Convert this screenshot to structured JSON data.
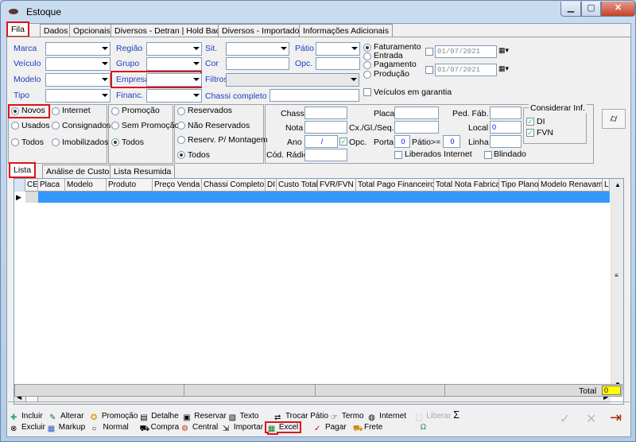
{
  "window": {
    "title": "Estoque",
    "min": "▁",
    "max": "▢",
    "close": "✕"
  },
  "main_tabs": [
    "Fila",
    "Dados",
    "Opcionais",
    "Diversos - Detran | Hold Back",
    "Diversos - Importados",
    "Informações Adicionais"
  ],
  "filters": {
    "marca": "Marca",
    "veiculo": "Veículo",
    "modelo": "Modelo",
    "tipo": "Tipo",
    "regiao": "Região",
    "grupo": "Grupo",
    "empresa": "Empresa",
    "financ": "Financ.",
    "sit": "Sit.",
    "cor": "Cor",
    "filtros": "Filtros",
    "chassi_completo": "Chassi completo",
    "patio": "Pátio",
    "opc": "Opc."
  },
  "date_radios": [
    "Faturamento",
    "Entrada",
    "Pagamento",
    "Produção"
  ],
  "date1": "01/07/2021",
  "date2": "01/07/2021",
  "veiculos_garantia": "Veículos em garantia",
  "radio_col1": [
    "Novos",
    "Usados",
    "Todos"
  ],
  "radio_col2": [
    "Internet",
    "Consignados",
    "Imobilizados"
  ],
  "radio_col3": [
    "Promoção",
    "Sem Promoção",
    "Todos"
  ],
  "radio_col4": [
    "Reservados",
    "Não Reservados",
    "Reserv. P/ Montagem",
    "Todos"
  ],
  "search": {
    "chassi": "Chassi",
    "nota": "Nota",
    "ano": "Ano",
    "ano_sep": "/",
    "opc": "Opc.",
    "cod_radio": "Cód. Rádio",
    "placa": "Placa",
    "cx": "Cx./Gl./Seq.",
    "porta": "Porta",
    "porta_val": "0",
    "patio": "Pátio>=",
    "patio_val": "0",
    "liberados": "Liberados Internet",
    "ped_fab": "Ped. Fáb.",
    "local": "Local",
    "local_val": "0",
    "linha": "Linha",
    "blindado": "Blindado",
    "considerar": "Considerar Inf.",
    "di": "DI",
    "fvn": "FVN"
  },
  "list_tabs": [
    "Lista",
    "Análise de Custos",
    "Lista Resumida"
  ],
  "columns": [
    "CE",
    "Placa",
    "Modelo",
    "Produto",
    "Preço Venda",
    "Chassi Completo",
    "DI",
    "Custo Total",
    "FVR/FVN",
    "Total Pago Financeiro",
    "Total Nota Fabrica",
    "Tipo Plano",
    "Modelo Renavam",
    "L"
  ],
  "total_label": "Total",
  "total_value": "0",
  "buttons_row1": [
    "Incluir",
    "Alterar",
    "Promoção",
    "Detalhe",
    "Reservar",
    "Texto",
    "Trocar Pátio",
    "Termo",
    "Internet",
    "Liberar"
  ],
  "buttons_row2": [
    "Excluir",
    "Markup",
    "Normal",
    "Compra",
    "Central",
    "Importar",
    "Excel",
    "Pagar",
    "Frete"
  ],
  "sigma": "Σ",
  "colors": {
    "accent": "#3399ff",
    "highlight": "#e0101a",
    "link": "#1a3fc0"
  }
}
